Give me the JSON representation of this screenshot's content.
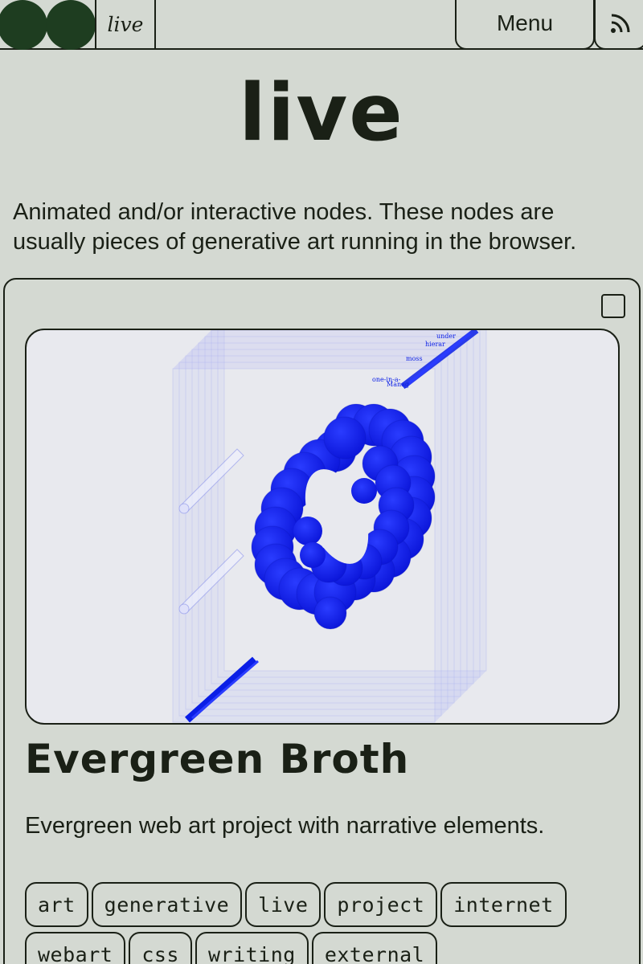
{
  "header": {
    "breadcrumb": "live",
    "menu_label": "Menu",
    "rss_icon": "rss-icon"
  },
  "page": {
    "title": "live",
    "intro": "Animated and/or interactive nodes. These nodes are usually pieces of generative art running in the browser."
  },
  "card": {
    "checkbox_checked": false,
    "title": "Evergreen Broth",
    "description": "Evergreen web art project with narrative elements.",
    "tags": [
      "art",
      "generative",
      "live",
      "project",
      "internet",
      "webart",
      "css",
      "writing",
      "external"
    ],
    "art_words": [
      "under",
      "hierar",
      "moss",
      "one-in-a-",
      "Manag"
    ],
    "colors": {
      "art_blue": "#0a1ee6",
      "art_bg": "#e8e9ee"
    }
  }
}
